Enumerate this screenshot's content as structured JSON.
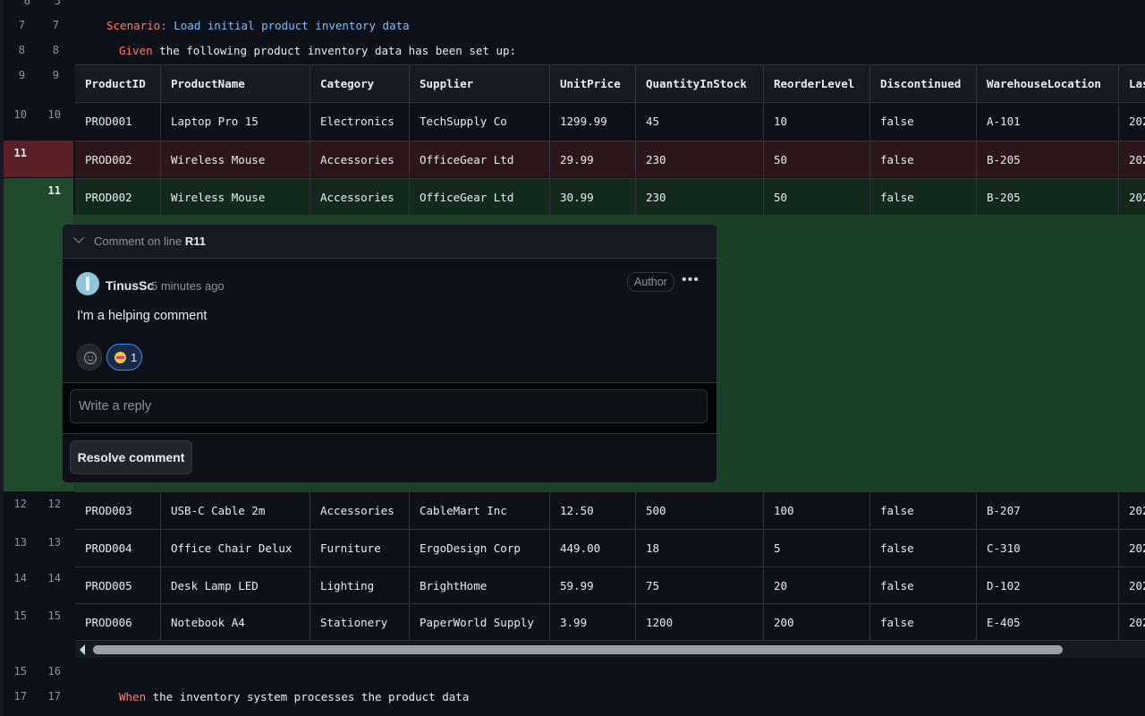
{
  "code": {
    "scenario_kw": "Scenario:",
    "scenario_text": " Load initial product inventory data",
    "given_kw": "Given",
    "given_text": " the following product inventory data has been set up:",
    "when_kw": "When",
    "when_text": " the inventory system processes the product data"
  },
  "line_numbers": {
    "top": [
      "6",
      "5"
    ],
    "l7": [
      "7",
      "7"
    ],
    "l8": [
      "8",
      "8"
    ],
    "l9": [
      "9",
      "9"
    ],
    "l10": [
      "10",
      "10"
    ],
    "del": "11",
    "add": "11",
    "l12": [
      "12",
      "12"
    ],
    "l13": [
      "13",
      "13"
    ],
    "l14": [
      "14",
      "14"
    ],
    "l15": [
      "15",
      "15"
    ],
    "l16": [
      "15",
      "16"
    ],
    "l17": [
      "17",
      "17"
    ]
  },
  "table": {
    "headers": [
      "ProductID",
      "ProductName",
      "Category",
      "Supplier",
      "UnitPrice",
      "QuantityInStock",
      "ReorderLevel",
      "Discontinued",
      "WarehouseLocation",
      "Las"
    ],
    "row1": [
      "PROD001",
      "Laptop Pro 15",
      "Electronics",
      "TechSupply Co",
      "1299.99",
      "45",
      "10",
      "false",
      "A-101",
      "202"
    ],
    "row_del": [
      "PROD002",
      "Wireless Mouse",
      "Accessories",
      "OfficeGear Ltd",
      "29.99",
      "230",
      "50",
      "false",
      "B-205",
      "202"
    ],
    "row_add": [
      "PROD002",
      "Wireless Mouse",
      "Accessories",
      "OfficeGear Ltd",
      "30.99",
      "230",
      "50",
      "false",
      "B-205",
      "202"
    ],
    "row3": [
      "PROD003",
      "USB-C Cable 2m",
      "Accessories",
      "CableMart Inc",
      "12.50",
      "500",
      "100",
      "false",
      "B-207",
      "202"
    ],
    "row4": [
      "PROD004",
      "Office Chair Delux",
      "Furniture",
      "ErgoDesign Corp",
      "449.00",
      "18",
      "5",
      "false",
      "C-310",
      "202"
    ],
    "row5": [
      "PROD005",
      "Desk Lamp LED",
      "Lighting",
      "BrightHome",
      "59.99",
      "75",
      "20",
      "false",
      "D-102",
      "202"
    ],
    "row6": [
      "PROD006",
      "Notebook A4",
      "Stationery",
      "PaperWorld Supply",
      "3.99",
      "1200",
      "200",
      "false",
      "E-405",
      "202"
    ]
  },
  "comment": {
    "header_prefix": "Comment on line",
    "header_line": "R11",
    "author": "TinusSc",
    "time": "5 minutes ago",
    "badge": "Author",
    "more": "•••",
    "body": "I'm a helping comment",
    "reaction_count": "1",
    "reply_placeholder": "Write a reply",
    "resolve_label": "Resolve comment"
  },
  "colors": {
    "deleted_gutter": "#5b2027",
    "added_gutter": "#1f4a2c",
    "keyword": "#ff7b72",
    "accent": "#79c0ff"
  }
}
